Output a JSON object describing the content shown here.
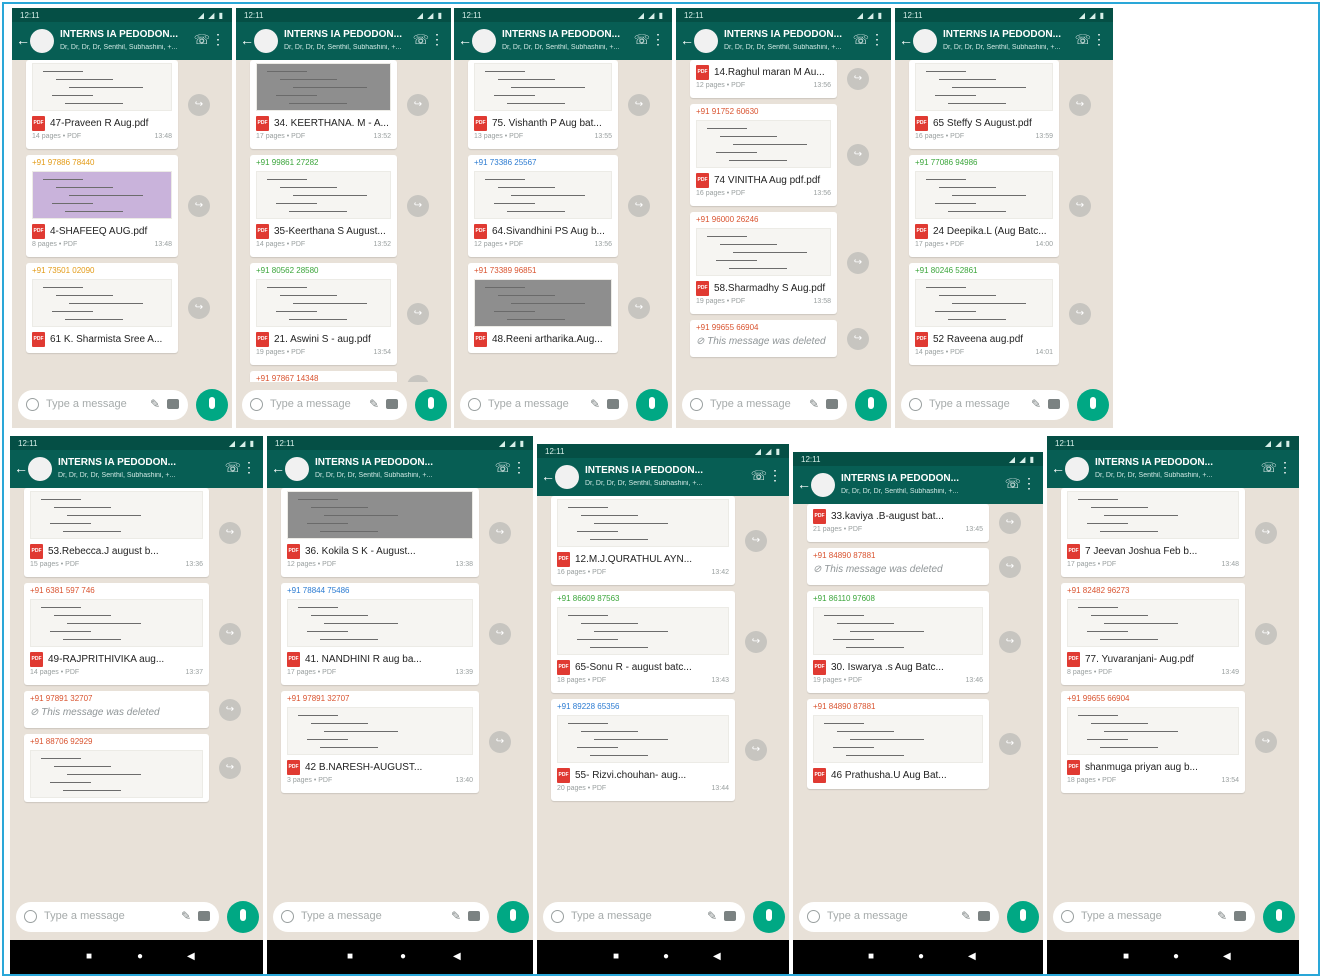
{
  "chat": {
    "title": "INTERNS IA PEDODON...",
    "subtitle": "Dr, Dr, Dr, Dr, Senthil, Subhashini, +...",
    "status_time": "12:11",
    "status_icons": "◢ ◢ ▮",
    "input_placeholder": "Type a message"
  },
  "icons": {
    "back": "back-arrow-icon",
    "call": "phone-plus-icon",
    "menu": "more-vert-icon",
    "forward": "forward-icon",
    "pdf": "pdf-file-icon",
    "mic": "microphone-icon"
  },
  "pdf_label": "PDF",
  "deleted_text": "This message was deleted",
  "nav": {
    "recent": "■",
    "home": "●",
    "back": "◀"
  },
  "colors": {
    "header": "#075e54",
    "status": "#054f45",
    "chat_bg": "#e8e1d8",
    "mic": "#00a884",
    "pdf": "#e03a32",
    "frame": "#2aa7d8"
  },
  "screens": [
    {
      "messages": [
        {
          "sender": "",
          "preview": true,
          "file": "47-Praveen R Aug.pdf",
          "meta": "14 pages • PDF",
          "time": "13:48"
        },
        {
          "sender": "+91 97886 78440",
          "sender_color": "#e39b17",
          "preview": "purple",
          "file": "4-SHAFEEQ AUG.pdf",
          "meta": "8 pages • PDF",
          "time": "13:48"
        },
        {
          "sender": "+91 73501 02090",
          "sender_color": "#e39b17",
          "preview": true,
          "file": "61 K. Sharmista Sree A...",
          "meta": "",
          "time": ""
        }
      ]
    },
    {
      "messages": [
        {
          "sender": "",
          "preview": "dark",
          "file": "34. KEERTHANA. M - A...",
          "meta": "17 pages • PDF",
          "time": "13:52"
        },
        {
          "sender": "+91 99861 27282",
          "sender_color": "#3aa53a",
          "preview": true,
          "file": "35-Keerthana S August...",
          "meta": "14 pages • PDF",
          "time": "13:52"
        },
        {
          "sender": "+91 80562 28580",
          "sender_color": "#3aa53a",
          "preview": true,
          "file": "21. Aswini S - aug.pdf",
          "meta": "19 pages • PDF",
          "time": "13:54"
        },
        {
          "sender": "+91 97867 14348",
          "sender_color": "#d9532f",
          "deleted": false,
          "file": "",
          "meta": "",
          "time": ""
        }
      ]
    },
    {
      "messages": [
        {
          "sender": "",
          "preview": true,
          "file": "75. Vishanth P Aug bat...",
          "meta": "13 pages • PDF",
          "time": "13:55"
        },
        {
          "sender": "+91 73386 25567",
          "sender_color": "#2b7bd2",
          "preview": true,
          "file": "64.Sivandhini PS Aug b...",
          "meta": "12 pages • PDF",
          "time": "13:56"
        },
        {
          "sender": "+91 73389 96851",
          "sender_color": "#d9532f",
          "preview": "dark",
          "file": "48.Reeni artharika.Aug...",
          "meta": "",
          "time": ""
        }
      ]
    },
    {
      "messages": [
        {
          "sender": "",
          "preview": false,
          "file": "14.Raghul maran M Au...",
          "meta": "12 pages • PDF",
          "time": "13:56"
        },
        {
          "sender": "+91 91752 60630",
          "sender_color": "#d9532f",
          "preview": true,
          "file": "74 VINITHA Aug pdf.pdf",
          "meta": "16 pages • PDF",
          "time": "13:56"
        },
        {
          "sender": "+91 96000 26246",
          "sender_color": "#d9532f",
          "preview": true,
          "file": "58.Sharmadhy S Aug.pdf",
          "meta": "19 pages • PDF",
          "time": "13:58"
        },
        {
          "sender": "+91 99655 66904",
          "sender_color": "#d9532f",
          "deleted": true,
          "file": "",
          "meta": "",
          "time": ""
        }
      ]
    },
    {
      "messages": [
        {
          "sender": "",
          "preview": true,
          "file": "65 Steffy S August.pdf",
          "meta": "16 pages • PDF",
          "time": "13:59"
        },
        {
          "sender": "+91 77086 94986",
          "sender_color": "#3aa53a",
          "preview": true,
          "file": "24 Deepika.L (Aug Batc...",
          "meta": "17 pages • PDF",
          "time": "14:00"
        },
        {
          "sender": "+91 80246 52861",
          "sender_color": "#3aa53a",
          "preview": true,
          "file": "52 Raveena aug.pdf",
          "meta": "14 pages • PDF",
          "time": "14:01"
        }
      ]
    },
    {
      "messages": [
        {
          "sender": "",
          "preview": true,
          "file": "53.Rebecca.J august b...",
          "meta": "15 pages • PDF",
          "time": "13:36"
        },
        {
          "sender": "+91 6381 597 746",
          "sender_color": "#d9532f",
          "preview": true,
          "file": "49-RAJPRITHIVIKA aug...",
          "meta": "14 pages • PDF",
          "time": "13:37"
        },
        {
          "sender": "+91 97891 32707",
          "sender_color": "#d9532f",
          "deleted": true,
          "file": "",
          "meta": "",
          "time": ""
        },
        {
          "sender": "+91 88706 92929",
          "sender_color": "#d9532f",
          "preview": true,
          "file": "",
          "meta": "",
          "time": ""
        }
      ]
    },
    {
      "messages": [
        {
          "sender": "",
          "preview": "dark",
          "file": "36. Kokila S K - August...",
          "meta": "12 pages • PDF",
          "time": "13:38"
        },
        {
          "sender": "+91 78844 75486",
          "sender_color": "#2b7bd2",
          "preview": true,
          "file": "41. NANDHINI R aug ba...",
          "meta": "17 pages • PDF",
          "time": "13:39"
        },
        {
          "sender": "+91 97891 32707",
          "sender_color": "#d9532f",
          "preview": true,
          "file": "42 B.NARESH-AUGUST...",
          "meta": "3 pages • PDF",
          "time": "13:40"
        }
      ]
    },
    {
      "messages": [
        {
          "sender": "",
          "preview": true,
          "file": "12.M.J.QURATHUL AYN...",
          "meta": "16 pages • PDF",
          "time": "13:42"
        },
        {
          "sender": "+91 86609 87563",
          "sender_color": "#3aa53a",
          "preview": true,
          "file": "65-Sonu R - august batc...",
          "meta": "18 pages • PDF",
          "time": "13:43"
        },
        {
          "sender": "+91 89228 65356",
          "sender_color": "#2b7bd2",
          "preview": true,
          "file": "55- Rizvi.chouhan- aug...",
          "meta": "20 pages • PDF",
          "time": "13:44"
        }
      ]
    },
    {
      "messages": [
        {
          "sender": "",
          "preview": false,
          "file": "33.kaviya .B-august bat...",
          "meta": "21 pages • PDF",
          "time": "13:45"
        },
        {
          "sender": "+91 84890 87881",
          "sender_color": "#d9532f",
          "deleted": true,
          "file": "",
          "meta": "",
          "time": ""
        },
        {
          "sender": "+91 86110 97608",
          "sender_color": "#3aa53a",
          "preview": true,
          "file": "30. Iswarya .s Aug Batc...",
          "meta": "19 pages • PDF",
          "time": "13:46"
        },
        {
          "sender": "+91 84890 87881",
          "sender_color": "#d9532f",
          "preview": true,
          "file": "46 Prathusha.U Aug Bat...",
          "meta": "",
          "time": ""
        }
      ]
    },
    {
      "messages": [
        {
          "sender": "",
          "preview": true,
          "file": "7 Jeevan Joshua Feb b...",
          "meta": "17 pages • PDF",
          "time": "13:48"
        },
        {
          "sender": "+91 82482 96273",
          "sender_color": "#d9532f",
          "preview": true,
          "file": "77. Yuvaranjani- Aug.pdf",
          "meta": "8 pages • PDF",
          "time": "13:49"
        },
        {
          "sender": "+91 99655 66904",
          "sender_color": "#d9532f",
          "preview": true,
          "file": "shanmuga priyan aug b...",
          "meta": "18 pages • PDF",
          "time": "13:54"
        }
      ]
    }
  ]
}
